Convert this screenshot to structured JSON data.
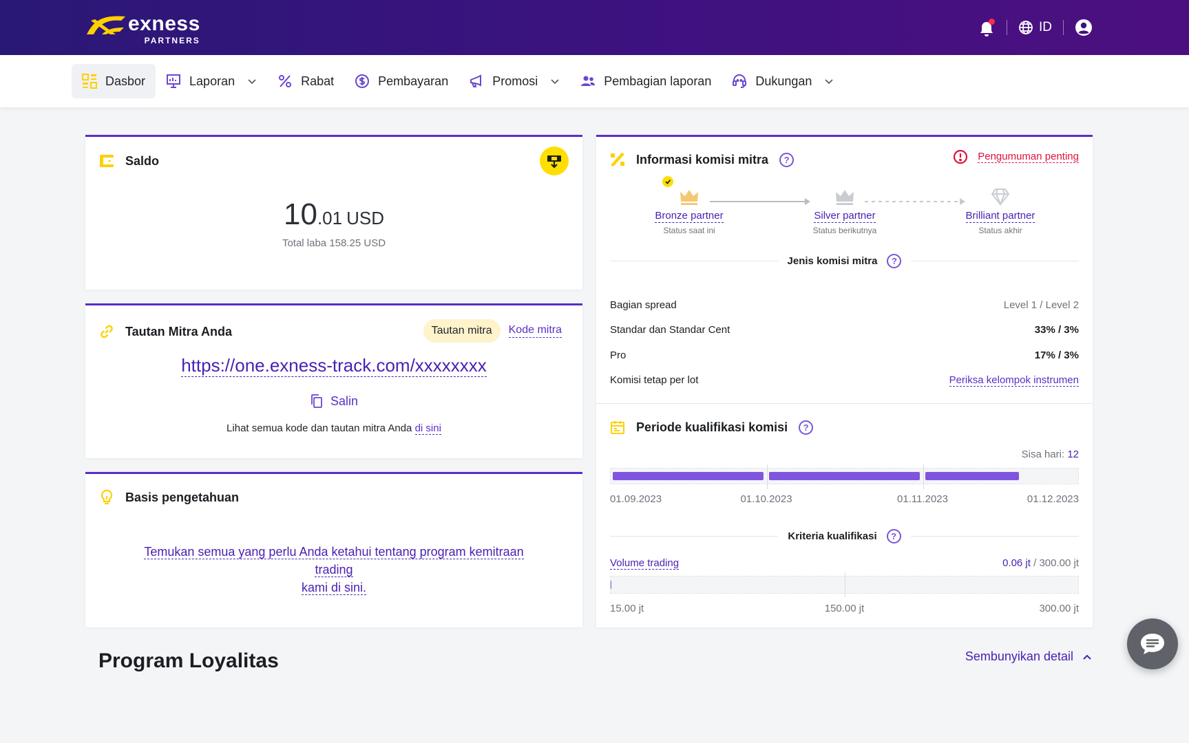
{
  "header": {
    "brand_name": "exness",
    "brand_sub": "PARTNERS",
    "language": "ID"
  },
  "nav": {
    "items": [
      {
        "label": "Dasbor"
      },
      {
        "label": "Laporan"
      },
      {
        "label": "Rabat"
      },
      {
        "label": "Pembayaran"
      },
      {
        "label": "Promosi"
      },
      {
        "label": "Pembagian laporan"
      },
      {
        "label": "Dukungan"
      }
    ]
  },
  "saldo": {
    "title": "Saldo",
    "amount_int": "10",
    "amount_dec": ".01",
    "currency": "USD",
    "total_profit": "Total laba 158.25 USD"
  },
  "partner_link": {
    "title": "Tautan Mitra Anda",
    "tab_link": "Tautan mitra",
    "tab_code": "Kode mitra",
    "url": "https://one.exness-track.com/xxxxxxxx",
    "copy_label": "Salin",
    "all_codes_text": "Lihat semua kode dan tautan mitra Anda",
    "all_codes_link": "di sini"
  },
  "knowledge": {
    "title": "Basis pengetahuan",
    "text_line1": "Temukan semua yang perlu Anda ketahui tentang program kemitraan trading",
    "text_line2": "kami di sini."
  },
  "commission": {
    "title": "Informasi komisi mitra",
    "announcement": "Pengumuman penting",
    "tiers": [
      {
        "name": "Bronze partner",
        "status": "Status saat ini"
      },
      {
        "name": "Silver partner",
        "status": "Status berikutnya"
      },
      {
        "name": "Brilliant partner",
        "status": "Status akhir"
      }
    ],
    "type_title": "Jenis komisi mitra",
    "rows": [
      {
        "label": "Bagian spread",
        "value": "Level 1 / Level 2"
      },
      {
        "label": "Standar dan Standar Cent",
        "value": "33% / 3%"
      },
      {
        "label": "Pro",
        "value": "17% / 3%"
      },
      {
        "label": "Komisi tetap per lot",
        "value": "Periksa kelompok instrumen"
      }
    ]
  },
  "period": {
    "title": "Periode kualifikasi komisi",
    "days_left_label": "Sisa hari:",
    "days_left": "12",
    "dates": [
      "01.09.2023",
      "01.10.2023",
      "01.11.2023",
      "01.12.2023"
    ],
    "segment_fill": [
      1.0,
      1.0,
      0.62
    ]
  },
  "criteria": {
    "title": "Kriteria kualifikasi",
    "volume_label": "Volume trading",
    "volume_current": "0.06 jt",
    "volume_target": " / 300.00 jt",
    "volume_fraction": 0.0002,
    "scale": [
      "15.00 jt",
      "150.00 jt",
      "300.00 jt"
    ]
  },
  "loyalty": {
    "title": "Program Loyalitas",
    "hide_detail": "Sembunyikan detail"
  },
  "colors": {
    "brand_purple": "#5a2ec4",
    "accent_yellow": "#ffde02",
    "alert_red": "#e0103d"
  }
}
